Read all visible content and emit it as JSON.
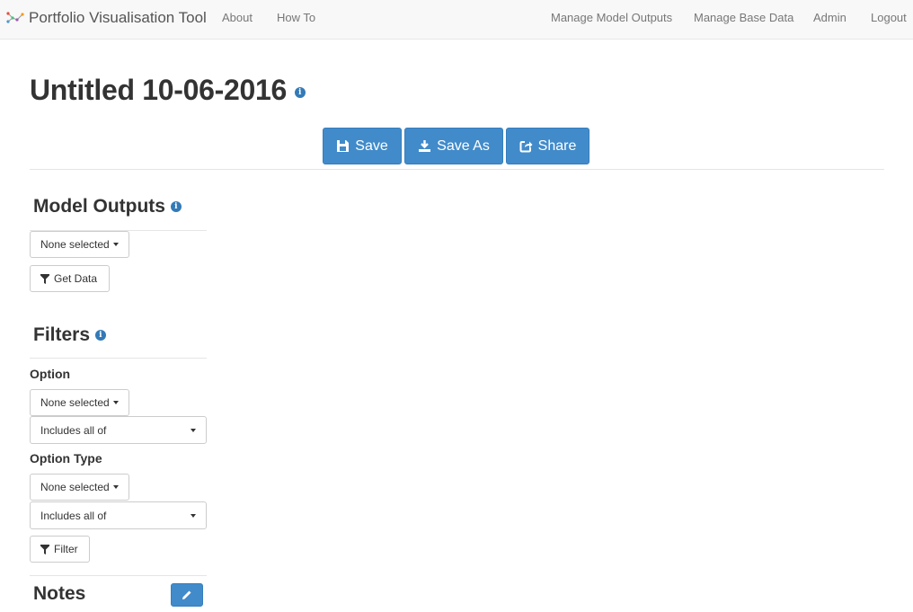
{
  "navbar": {
    "brand": "Portfolio Visualisation Tool",
    "left_links": [
      "About",
      "How To"
    ],
    "right_links": [
      "Manage Model Outputs",
      "Manage Base Data",
      "Admin",
      "Logout"
    ]
  },
  "page": {
    "title": "Untitled 10-06-2016",
    "info_glyph": "i"
  },
  "toolbar": {
    "save_label": "Save",
    "save_as_label": "Save As",
    "share_label": "Share"
  },
  "model_outputs": {
    "heading": "Model Outputs",
    "dropdown_value": "None selected",
    "get_data_label": "Get Data"
  },
  "filters": {
    "heading": "Filters",
    "option_label": "Option",
    "option_value": "None selected",
    "option_match": "Includes all of",
    "option_type_label": "Option Type",
    "option_type_value": "None selected",
    "option_type_match": "Includes all of",
    "filter_label": "Filter"
  },
  "notes": {
    "heading": "Notes"
  },
  "colors": {
    "primary": "#428bca",
    "info": "#337ab7",
    "navbar_bg": "#f8f8f8"
  },
  "icons": [
    "logo-icon",
    "info-icon",
    "save-icon",
    "save-as-icon",
    "share-icon",
    "filter-icon",
    "pencil-icon",
    "caret-down-icon"
  ]
}
